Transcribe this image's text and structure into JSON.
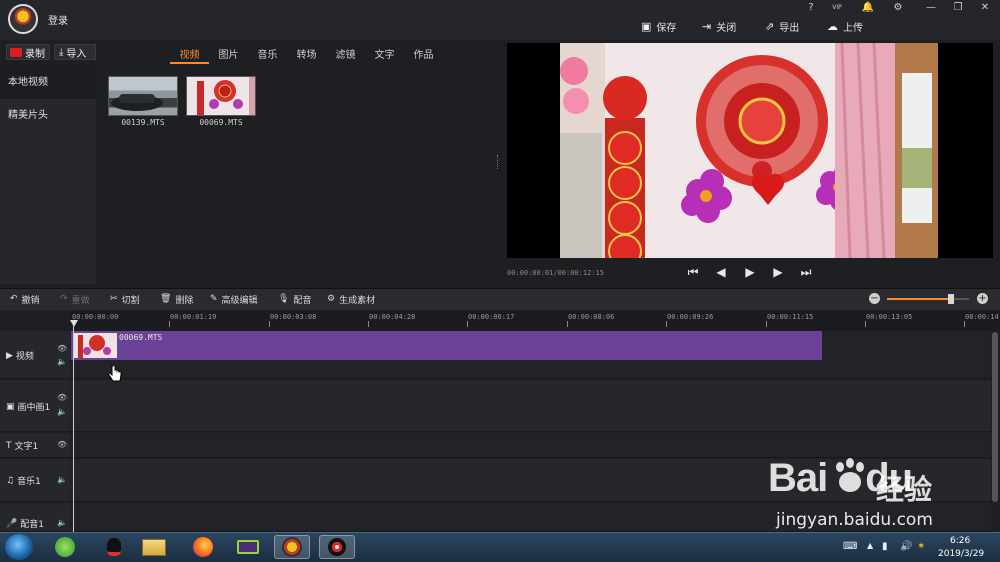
{
  "header": {
    "login": "登录",
    "sys_icons": [
      "?",
      "VIP",
      "🔔",
      "⚙",
      "—",
      "❐",
      "✕"
    ],
    "actions": [
      {
        "label": "保存",
        "icon": "save-icon"
      },
      {
        "label": "关闭",
        "icon": "close-doc-icon"
      },
      {
        "label": "导出",
        "icon": "export-icon"
      },
      {
        "label": "上传",
        "icon": "upload-icon"
      }
    ]
  },
  "library": {
    "record_label": "录制",
    "import_label": "导入",
    "tabs": [
      "视频",
      "图片",
      "音乐",
      "转场",
      "滤镜",
      "文字",
      "作品"
    ],
    "active_tab": "视频",
    "sidebar": [
      "本地视频",
      "精美片头"
    ],
    "files": [
      "00139.MTS",
      "00069.MTS"
    ]
  },
  "preview": {
    "timecode": "00:00:00:01/00:00:12:15"
  },
  "edit_toolbar": {
    "undo": "撤销",
    "redo": "重做",
    "cut": "切割",
    "delete": "删除",
    "advanced": "高级编辑",
    "dub": "配音",
    "generate": "生成素材",
    "zoom_level": 0.78
  },
  "ruler": {
    "labels": [
      "00:00:00:00",
      "00:00:01:19",
      "00:00:03:08",
      "00:00:04:28",
      "00:00:06:17",
      "00:00:08:06",
      "00:00:09:26",
      "00:00:11:15",
      "00:00:13:05",
      "00:00:14:"
    ]
  },
  "tracks": [
    {
      "name": "视频",
      "icon": "video-track-icon"
    },
    {
      "name": "画中画1",
      "icon": "pip-track-icon"
    },
    {
      "name": "文字1",
      "icon": "text-track-icon"
    },
    {
      "name": "音乐1",
      "icon": "music-track-icon"
    },
    {
      "name": "配音1",
      "icon": "mic-track-icon"
    }
  ],
  "clip": {
    "label": "00069.MTS"
  },
  "taskbar": {
    "time": "6:26",
    "date": "2019/3/29"
  },
  "watermark": {
    "logo": "Bai",
    "logo2": "du",
    "cn": "经验",
    "url": "jingyan.baidu.com"
  }
}
